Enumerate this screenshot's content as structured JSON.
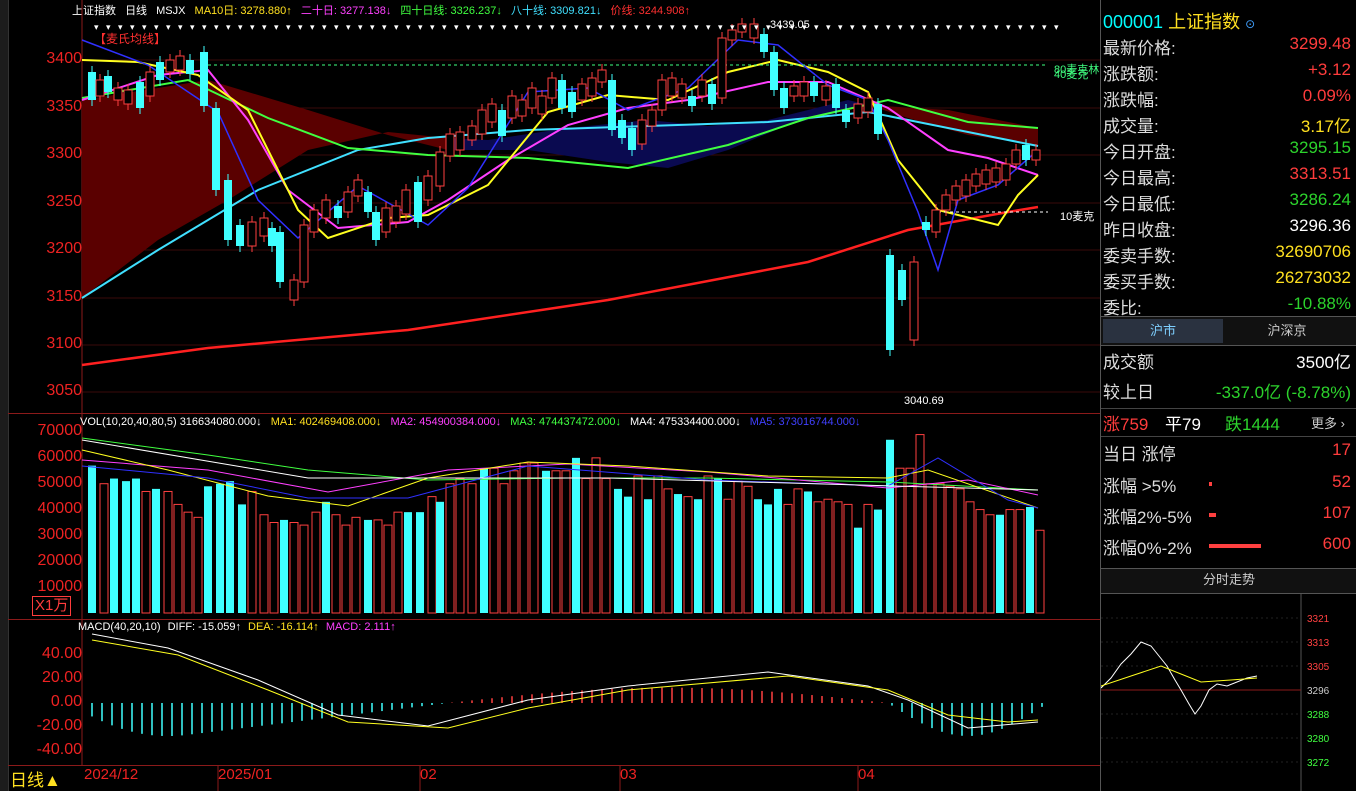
{
  "legend": {
    "title": "上证指数",
    "period": "日线",
    "ind": "MSJX",
    "ma10": "MA10日: 3278.880↑",
    "ma20": "二十日: 3277.138↓",
    "ma40": "四十日线: 3326.237↓",
    "ma80": "八十线: 3309.821↓",
    "ma250": "价线: 3244.908↑"
  },
  "tag_label": "【麦氏均线】",
  "price_axis": [
    "3400",
    "3350",
    "3300",
    "3250",
    "3200",
    "3150",
    "3100",
    "3050"
  ],
  "price_annotations": {
    "high": "3439.05",
    "low": "3040.69",
    "r1": "80麦克林",
    "r2": "40麦克",
    "r3": "10麦克"
  },
  "vol_legend": {
    "vol": "VOL(10,20,40,80,5)",
    "vol_val": "316634080.000↓",
    "ma1": "MA1: 402469408.000↓",
    "ma2": "MA2: 454900384.000↓",
    "ma3": "MA3: 474437472.000↓",
    "ma4": "MA4: 475334400.000↓",
    "ma5": "MA5: 373016744.000↓"
  },
  "vol_axis": [
    "70000",
    "60000",
    "50000",
    "40000",
    "30000",
    "20000",
    "10000"
  ],
  "vol_unit": "X1万",
  "macd_legend": {
    "name": "MACD(40,20,10)",
    "diff": "DIFF: -15.059↑",
    "dea": "DEA: -16.114↑",
    "macd": "MACD: 2.111↑"
  },
  "macd_axis": [
    "40.00",
    "20.00",
    "0.00",
    "-20.00",
    "-40.00"
  ],
  "period_label": "日线▲",
  "x_axis": [
    "2024/12",
    "2025/01",
    "02",
    "03",
    "04"
  ],
  "right": {
    "code": "000001",
    "name": "上证指数",
    "rows": [
      {
        "k": "最新价格:",
        "v": "3299.48",
        "c": "red"
      },
      {
        "k": "涨跌额:",
        "v": "+3.12",
        "c": "red"
      },
      {
        "k": "涨跌幅:",
        "v": "0.09%",
        "c": "red"
      },
      {
        "k": "成交量:",
        "v": "3.17亿",
        "c": "yellow"
      },
      {
        "k": "今日开盘:",
        "v": "3295.15",
        "c": "green"
      },
      {
        "k": "今日最高:",
        "v": "3313.51",
        "c": "red"
      },
      {
        "k": "今日最低:",
        "v": "3286.24",
        "c": "green"
      },
      {
        "k": "昨日收盘:",
        "v": "3296.36",
        "c": "white"
      },
      {
        "k": "委卖手数:",
        "v": "32690706",
        "c": "yellow"
      },
      {
        "k": "委买手数:",
        "v": "26273032",
        "c": "yellow"
      },
      {
        "k": "委比:",
        "v": "-10.88%",
        "c": "green"
      }
    ],
    "tabs": [
      "沪市",
      "沪深京"
    ],
    "amount_k": "成交额",
    "amount_v": "3500亿",
    "cmp_k": "较上日",
    "cmp_v": "-337.0亿 (-8.78%)",
    "up": "涨759",
    "flat": "平79",
    "down": "跌1444",
    "more": "更多 ›",
    "limit_k": "当日 涨停",
    "limit_v": "17",
    "b1_k": "涨幅 >5%",
    "b1_v": "52",
    "b2_k": "涨幅2%-5%",
    "b2_v": "107",
    "b3_k": "涨幅0%-2%",
    "b3_v": "600",
    "mini_title": "分时走势",
    "mini_axis": [
      "3321",
      "3313",
      "3305",
      "3296",
      "3288",
      "3280",
      "3272"
    ]
  },
  "colors": {
    "up": "#ff4040",
    "down": "#40ffff",
    "bg": "#000000",
    "grid": "#8b1a1a"
  }
}
